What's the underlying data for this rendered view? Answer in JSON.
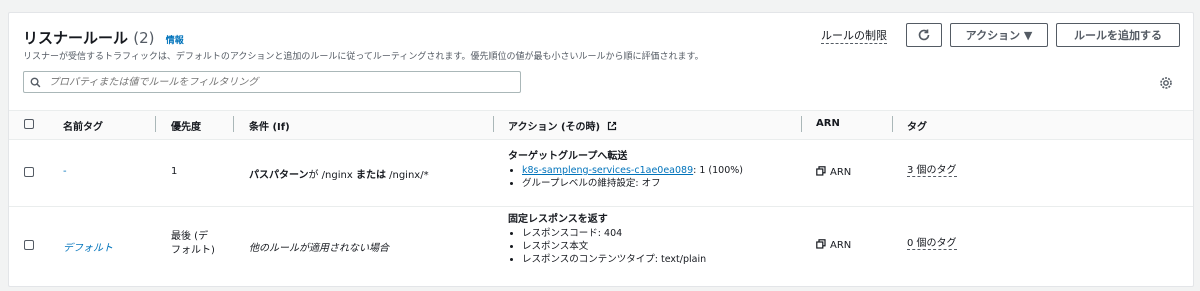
{
  "header": {
    "title": "リスナールール",
    "count": "(2)",
    "info": "情報",
    "description": "リスナーが受信するトラフィックは、デフォルトのアクションと追加のルールに従ってルーティングされます。優先順位の値が最も小さいルールから順に評価されます。",
    "limits_link": "ルールの制限",
    "actions_button": "アクション ▼",
    "add_rule_button": "ルールを追加する"
  },
  "search": {
    "placeholder": "プロパティまたは値でルールをフィルタリング"
  },
  "table": {
    "columns": [
      "名前タグ",
      "優先度",
      "条件 (If)",
      "アクション (その時)",
      "ARN",
      "タグ"
    ],
    "rows": [
      {
        "name": "-",
        "priority": "1",
        "condition_bold": "パスパターン",
        "condition_mid": "が /nginx ",
        "condition_bold2": "または",
        "condition_tail": " /nginx/*",
        "action_title": "ターゲットグループへ転送",
        "action_link": "k8s-sampleng-services-c1ae0ea089",
        "action_link_suffix": ": 1 (100%)",
        "action_item2": "グループレベルの維持設定: オフ",
        "arn": "ARN",
        "tags": "3 個のタグ"
      },
      {
        "name": "デフォルト",
        "priority_line1": "最後 (デ",
        "priority_line2": "フォルト)",
        "condition": "他のルールが適用されない場合",
        "action_title": "固定レスポンスを返す",
        "action_item1": "レスポンスコード: 404",
        "action_item2": "レスポンス本文",
        "action_item3": "レスポンスのコンテンツタイプ: text/plain",
        "arn": "ARN",
        "tags": "0 個のタグ"
      }
    ]
  }
}
